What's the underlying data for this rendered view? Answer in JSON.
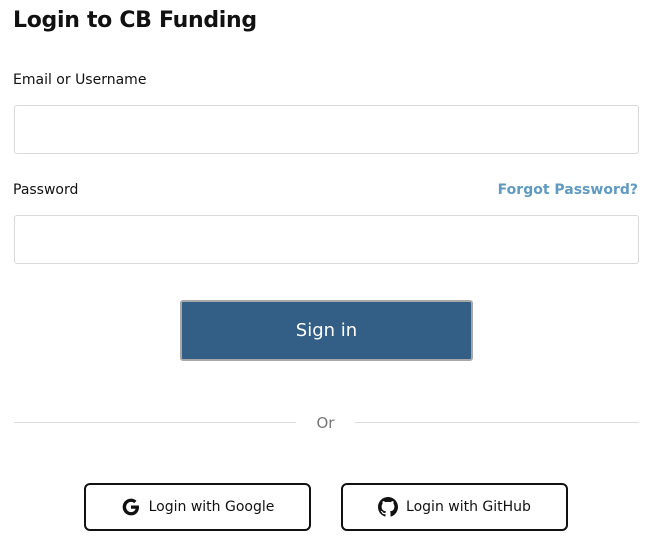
{
  "page": {
    "title": "Login to CB Funding"
  },
  "form": {
    "email_label": "Email or Username",
    "email_value": "",
    "email_placeholder": "",
    "password_label": "Password",
    "password_value": "",
    "password_placeholder": "",
    "forgot_password_label": "Forgot Password?",
    "signin_label": "Sign in"
  },
  "divider": {
    "text": "Or"
  },
  "social": {
    "google_label": "Login with Google",
    "google_icon": "google-icon",
    "github_label": "Login with GitHub",
    "github_icon": "github-icon"
  },
  "colors": {
    "primary_button": "#335e86",
    "link": "#5f9bc1",
    "text": "#111111"
  }
}
